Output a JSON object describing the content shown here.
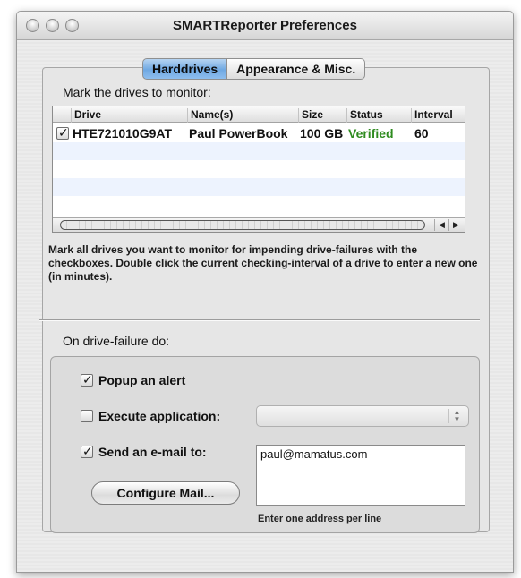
{
  "window": {
    "title": "SMARTReporter Preferences"
  },
  "tabs": [
    {
      "label": "Harddrives",
      "selected": true
    },
    {
      "label": "Appearance & Misc.",
      "selected": false
    }
  ],
  "drives": {
    "heading": "Mark the drives to monitor:",
    "columns": [
      "Drive",
      "Name(s)",
      "Size",
      "Status",
      "Interval"
    ],
    "rows": [
      {
        "checked": true,
        "drive": "HTE721010G9AT",
        "name": "Paul PowerBook",
        "size": "100 GB",
        "status": "Verified",
        "interval": "60"
      }
    ],
    "help": "Mark all drives you want to monitor for impending drive-failures with the checkboxes. Double click the current checking-interval of a drive to enter a new one (in minutes)."
  },
  "failure": {
    "heading": "On drive-failure do:",
    "popup_alert": {
      "label": "Popup an alert",
      "checked": true
    },
    "execute_app": {
      "label": "Execute application:",
      "checked": false
    },
    "send_email": {
      "label": "Send an e-mail to:",
      "checked": true
    },
    "email_value": "paul@mamatus.com",
    "configure_label": "Configure Mail...",
    "email_hint": "Enter one address per line"
  },
  "colors": {
    "tab_selected": "#6fa8e2",
    "status_verified": "#2e8b1f"
  }
}
